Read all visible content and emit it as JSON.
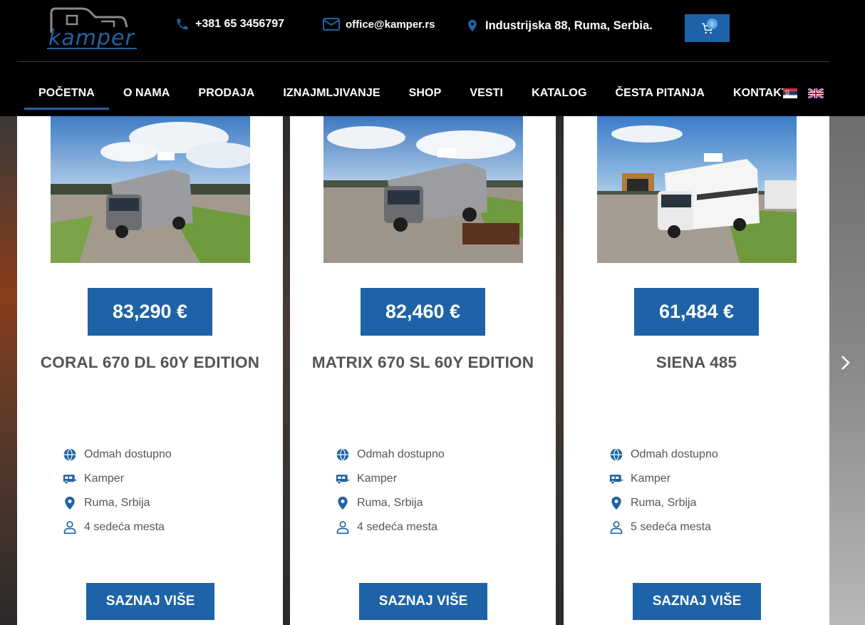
{
  "header": {
    "logo_text": "kamper",
    "phone": "+381 65 3456797",
    "email": "office@kamper.rs",
    "address": "Industrijska 88, Ruma, Serbia.",
    "cart_count": "0",
    "accent_color": "#1e63a7"
  },
  "nav": {
    "items": [
      {
        "label": "POČETNA"
      },
      {
        "label": "O NAMA"
      },
      {
        "label": "PRODAJA"
      },
      {
        "label": "IZNAJMLJIVANJE"
      },
      {
        "label": "SHOP"
      },
      {
        "label": "VESTI"
      },
      {
        "label": "KATALOG"
      },
      {
        "label": "ČESTA PITANJA"
      },
      {
        "label": "KONTAKT"
      }
    ],
    "active": "POČETNA"
  },
  "cards": [
    {
      "price": "83,290 €",
      "title": "CORAL 670 DL 60Y EDITION",
      "availability": "Odmah dostupno",
      "type": "Kamper",
      "location": "Ruma, Srbija",
      "seats": "4 sedeća mesta",
      "button": "SAZNAJ VIŠE"
    },
    {
      "price": "82,460 €",
      "title": "MATRIX 670 SL 60Y EDITION",
      "availability": "Odmah dostupno",
      "type": "Kamper",
      "location": "Ruma, Srbija",
      "seats": "4 sedeća mesta",
      "button": "SAZNAJ VIŠE"
    },
    {
      "price": "61,484 €",
      "title": "SIENA 485",
      "availability": "Odmah dostupno",
      "type": "Kamper",
      "location": "Ruma, Srbija",
      "seats": "5 sedeća mesta",
      "button": "SAZNAJ VIŠE"
    }
  ]
}
